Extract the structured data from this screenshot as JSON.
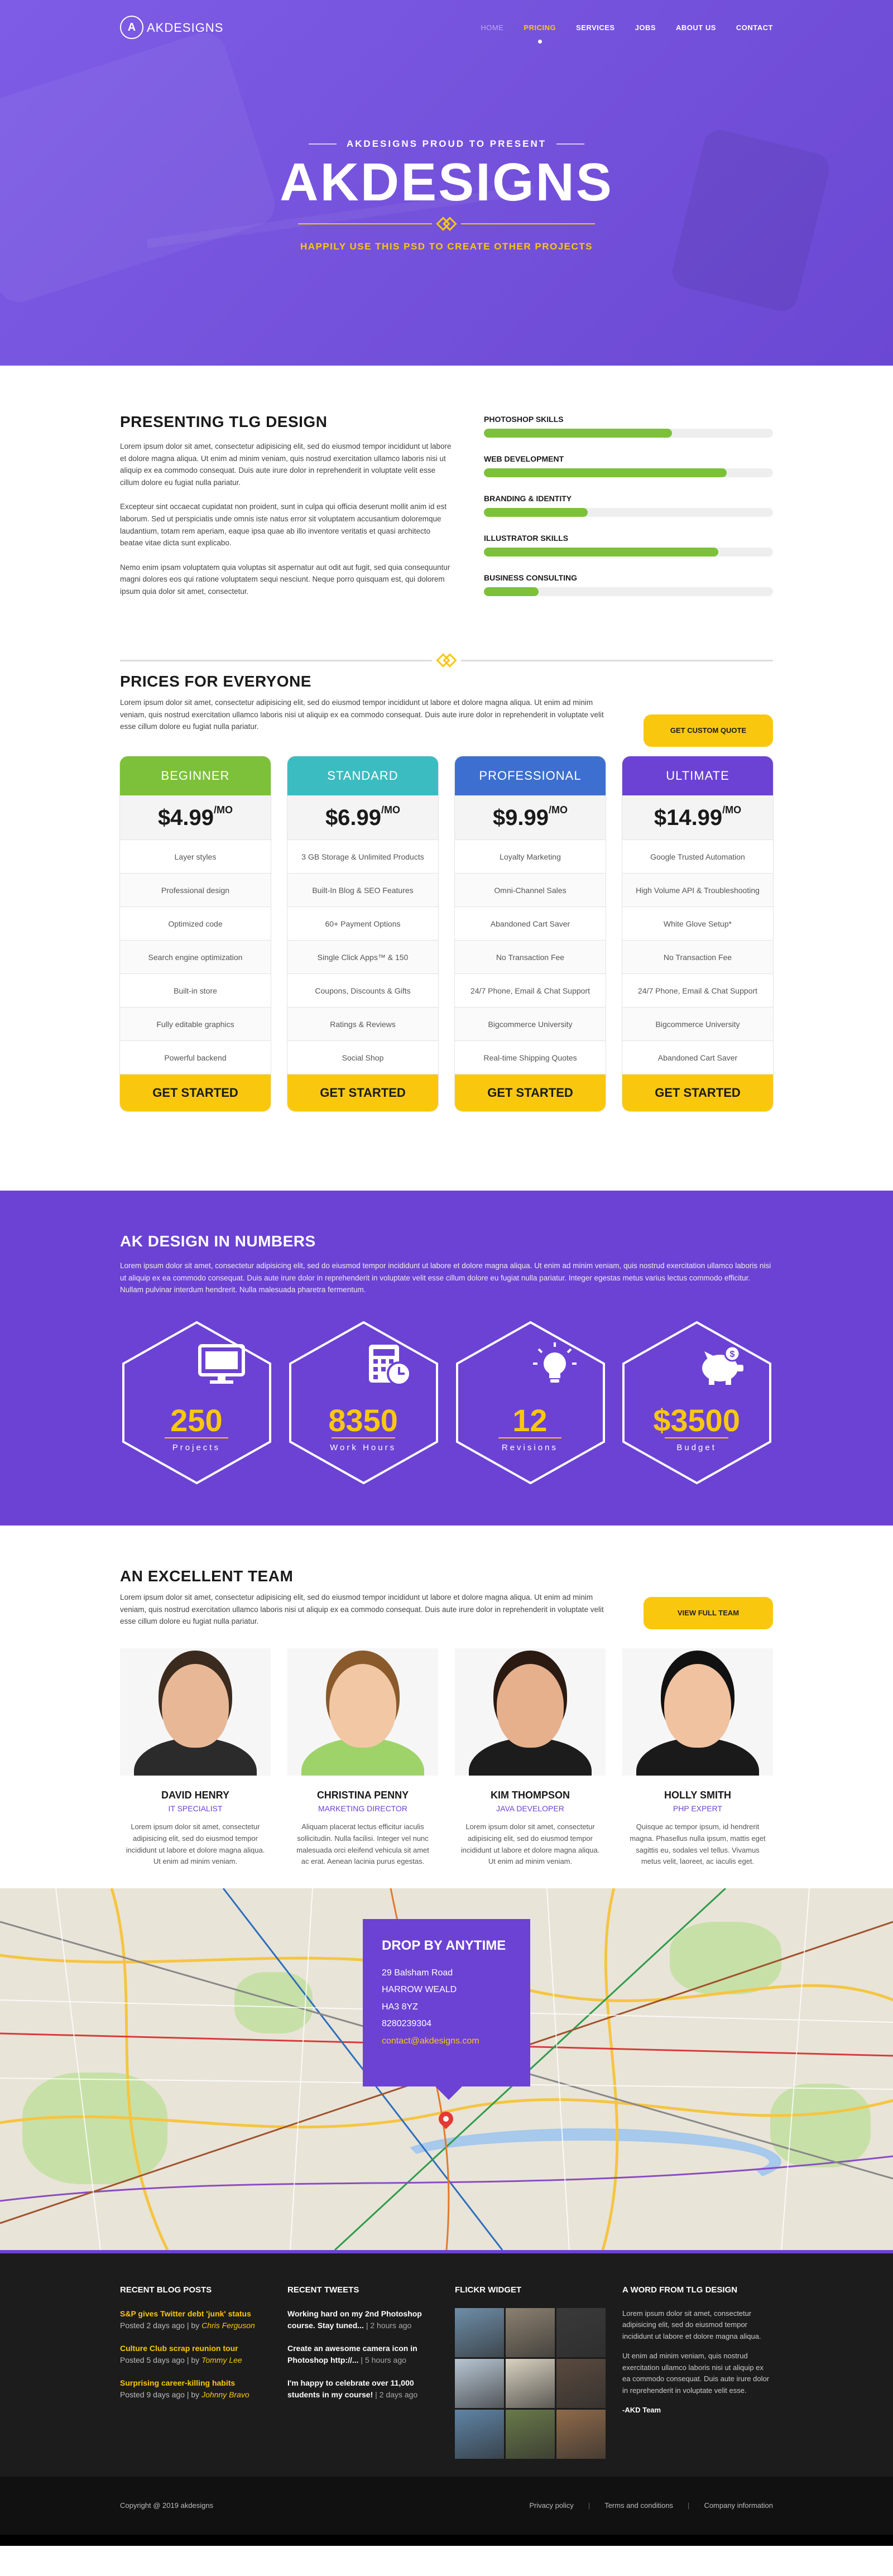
{
  "nav": {
    "logo_mark": "A",
    "logo_text": "AKDESIGNS",
    "items": [
      "HOME",
      "PRICING",
      "SERVICES",
      "JOBS",
      "ABOUT US",
      "CONTACT"
    ]
  },
  "hero": {
    "subtitle": "AKDESIGNS PROUD TO PRESENT",
    "title": "AKDESIGNS",
    "tagline": "HAPPILY USE THIS PSD TO CREATE OTHER PROJECTS"
  },
  "present": {
    "heading": "PRESENTING TLG DESIGN",
    "paragraphs": [
      "Lorem ipsum dolor sit amet, consectetur adipisicing elit, sed do eiusmod tempor incididunt ut labore et dolore magna aliqua. Ut enim ad minim veniam, quis nostrud exercitation ullamco laboris nisi ut aliquip ex ea commodo consequat. Duis aute irure dolor in reprehenderit in voluptate velit esse cillum dolore eu fugiat nulla pariatur.",
      "Excepteur sint occaecat cupidatat non proident, sunt in culpa qui officia deserunt mollit anim id est laborum. Sed ut perspiciatis unde omnis iste natus error sit voluptatem accusantium doloremque laudantium, totam rem aperiam, eaque ipsa quae ab illo inventore veritatis et quasi architecto beatae vitae dicta sunt explicabo.",
      "Nemo enim ipsam voluptatem quia voluptas sit aspernatur aut odit aut fugit, sed quia consequuntur magni dolores eos qui ratione voluptatem sequi nesciunt. Neque porro quisquam est, qui dolorem ipsum quia dolor sit amet, consectetur."
    ],
    "skills": [
      {
        "label": "PHOTOSHOP SKILLS",
        "fill_pct": 65
      },
      {
        "label": "WEB DEVELOPMENT",
        "fill_pct": 84
      },
      {
        "label": "BRANDING & IDENTITY",
        "fill_pct": 36
      },
      {
        "label": "ILLUSTRATOR SKILLS",
        "fill_pct": 81
      },
      {
        "label": "BUSINESS CONSULTING",
        "fill_pct": 19
      }
    ]
  },
  "pricing": {
    "heading": "PRICES FOR EVERYONE",
    "intro": "Lorem ipsum dolor sit amet, consectetur adipisicing elit, sed do eiusmod tempor incididunt ut labore et dolore magna aliqua. Ut enim ad minim veniam, quis nostrud exercitation ullamco laboris nisi ut aliquip ex ea commodo consequat. Duis aute irure dolor in reprehenderit in voluptate velit esse cillum dolore eu fugiat nulla pariatur.",
    "quote_button": "GET CUSTOM QUOTE",
    "plans": [
      {
        "name": "BEGINNER",
        "color": "#7cc139",
        "price": "$4.99",
        "per": "/MO",
        "features": [
          "Layer styles",
          "Professional design",
          "Optimized code",
          "Search engine optimization",
          "Built-in store",
          "Fully editable graphics",
          "Powerful backend"
        ],
        "cta": "GET STARTED"
      },
      {
        "name": "STANDARD",
        "color": "#3bbcc1",
        "price": "$6.99",
        "per": "/MO",
        "features": [
          "3 GB Storage & Unlimited Products",
          "Built-In Blog & SEO Features",
          "60+ Payment Options",
          "Single Click Apps™ & 150",
          "Coupons, Discounts & Gifts",
          "Ratings & Reviews",
          "Social Shop"
        ],
        "cta": "GET STARTED"
      },
      {
        "name": "PROFESSIONAL",
        "color": "#3d6fd0",
        "price": "$9.99",
        "per": "/MO",
        "features": [
          "Loyalty Marketing",
          "Omni-Channel Sales",
          "Abandoned Cart Saver",
          "No Transaction Fee",
          "24/7 Phone, Email & Chat Support",
          "Bigcommerce University",
          "Real-time Shipping Quotes"
        ],
        "cta": "GET STARTED"
      },
      {
        "name": "ULTIMATE",
        "color": "#6c42d4",
        "price": "$14.99",
        "per": "/MO",
        "features": [
          "Google Trusted Automation",
          "High Volume API & Troubleshooting",
          "White Glove Setup*",
          "No Transaction Fee",
          "24/7 Phone, Email & Chat Support",
          "Bigcommerce University",
          "Abandoned Cart Saver"
        ],
        "cta": "GET STARTED"
      }
    ]
  },
  "numbers": {
    "heading": "AK DESIGN IN NUMBERS",
    "intro": "Lorem ipsum dolor sit amet, consectetur adipisicing elit, sed do eiusmod tempor incididunt ut labore et dolore magna aliqua. Ut enim ad minim veniam, quis nostrud exercitation ullamco laboris nisi ut aliquip ex ea commodo consequat. Duis aute irure dolor in reprehenderit in voluptate velit esse cillum dolore eu fugiat nulla pariatur. Integer egestas metus varius lectus commodo efficitur. Nullam pulvinar interdum hendrerit. Nulla malesuada pharetra fermentum.",
    "stats": [
      {
        "icon": "monitor-icon",
        "value": "250",
        "label": "Projects"
      },
      {
        "icon": "calculator-clock-icon",
        "value": "8350",
        "label": "Work Hours"
      },
      {
        "icon": "lightbulb-icon",
        "value": "12",
        "label": "Revisions"
      },
      {
        "icon": "piggy-bank-icon",
        "value": "$3500",
        "label": "Budget"
      }
    ]
  },
  "team": {
    "heading": "AN EXCELLENT TEAM",
    "intro": "Lorem ipsum dolor sit amet, consectetur adipisicing elit, sed do eiusmod tempor incididunt ut labore et dolore magna aliqua. Ut enim ad minim veniam, quis nostrud exercitation ullamco laboris nisi ut aliquip ex ea commodo consequat. Duis aute irure dolor in reprehenderit in voluptate velit esse cillum dolore eu fugiat nulla pariatur.",
    "view_button": "VIEW FULL TEAM",
    "members": [
      {
        "name": "DAVID HENRY",
        "role": "IT SPECIALIST",
        "bio": "Lorem ipsum dolor sit amet, consectetur adipisicing elit, sed do eiusmod tempor incididunt ut labore et dolore magna aliqua. Ut enim ad minim veniam."
      },
      {
        "name": "CHRISTINA PENNY",
        "role": "MARKETING DIRECTOR",
        "bio": "Aliquam placerat lectus efficitur iaculis sollicitudin. Nulla facilisi. Integer vel nunc malesuada orci eleifend vehicula sit amet ac erat. Aenean lacinia purus egestas."
      },
      {
        "name": "KIM THOMPSON",
        "role": "JAVA DEVELOPER",
        "bio": "Lorem ipsum dolor sit amet, consectetur adipisicing elit, sed do eiusmod tempor incididunt ut labore et dolore magna aliqua. Ut enim ad minim veniam."
      },
      {
        "name": "HOLLY SMITH",
        "role": "PHP EXPERT",
        "bio": "Quisque ac tempor ipsum, id hendrerit magna. Phasellus nulla ipsum, mattis eget sagittis eu, sodales vel tellus. Vivamus metus velit, laoreet, ac iaculis eget."
      }
    ]
  },
  "contact": {
    "heading": "DROP BY ANYTIME",
    "lines": [
      "29 Balsham Road",
      "HARROW WEALD",
      "HA3 8YZ",
      "8280239304"
    ],
    "email": "contact@akdesigns.com"
  },
  "footer": {
    "blog_heading": "RECENT BLOG POSTS",
    "posts": [
      {
        "title": "S&P gives Twitter debt 'junk' status",
        "meta": "Posted 2 days ago | by ",
        "author": "Chris Ferguson"
      },
      {
        "title": "Culture Club scrap reunion tour",
        "meta": "Posted 5 days ago | by ",
        "author": "Tommy Lee"
      },
      {
        "title": "Surprising career-killing habits",
        "meta": "Posted 9 days ago | by ",
        "author": "Johnny Bravo"
      }
    ],
    "tweets_heading": "RECENT TWEETS",
    "tweets": [
      {
        "text": "Working hard on my 2nd Photoshop course. Stay tuned...",
        "time": " | 2 hours ago"
      },
      {
        "text": "Create an awesome camera icon in Photoshop http://...",
        "time": " | 5 hours ago"
      },
      {
        "text": "I'm happy to celebrate over 11,000 students in my course!",
        "time": " | 2 days ago"
      }
    ],
    "flickr_heading": "FLICKR WIDGET",
    "flickr_colors": [
      "#6e8ea8",
      "#8c8170",
      "#3a3a3a",
      "#b7c6d3",
      "#d9d2c0",
      "#5a4a3e",
      "#5f84a6",
      "#6a7a4a",
      "#8f6a4a"
    ],
    "word_heading": "A WORD FROM TLG DESIGN",
    "word_paragraphs": [
      "Lorem ipsum dolor sit amet, consectetur adipisicing elit, sed do eiusmod tempor incididunt ut labore et dolore magna aliqua.",
      "Ut enim ad minim veniam, quis nostrud exercitation ullamco laboris nisi ut aliquip ex ea commodo consequat. Duis aute irure dolor in reprehenderit in voluptate velit esse."
    ],
    "word_sign": "-AKD Team",
    "copyright": "Copyright @ 2019  akdesigns",
    "links": [
      "Privacy policy",
      "Terms and conditions",
      "Company information"
    ]
  }
}
